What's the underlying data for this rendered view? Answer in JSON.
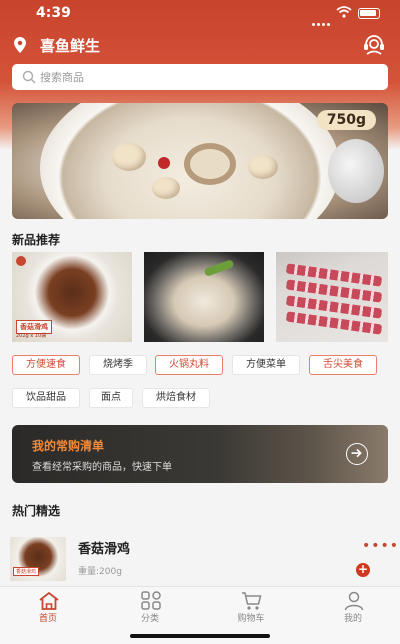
{
  "status_bar": {
    "time": "4:39"
  },
  "header": {
    "app_title": "喜鱼鲜生"
  },
  "search": {
    "placeholder": "搜索商品"
  },
  "banner": {
    "weight_label": "750g"
  },
  "new_products": {
    "title": "新品推荐",
    "items": [
      {
        "name": "香菇滑鸡",
        "image_text": "香菇滑鸡",
        "image_subtext": "202g x 10袋"
      },
      {
        "name": "",
        "image_text": ""
      },
      {
        "name": "",
        "image_text": ""
      }
    ]
  },
  "category_tags": [
    {
      "label": "方便速食",
      "style": "red"
    },
    {
      "label": "烧烤季",
      "style": "gray"
    },
    {
      "label": "火锅丸料",
      "style": "red"
    },
    {
      "label": "方便菜单",
      "style": "gray"
    },
    {
      "label": "舌尖美食",
      "style": "red"
    },
    {
      "label": "饮品甜品",
      "style": "gray"
    },
    {
      "label": "面点",
      "style": "gray"
    },
    {
      "label": "烘焙食材",
      "style": "gray"
    }
  ],
  "frequent_list": {
    "title": "我的常购清单",
    "subtitle": "查看经常采购的商品，快速下单"
  },
  "hot_picks": {
    "title": "热门精选",
    "items": [
      {
        "name": "香菇滑鸡",
        "weight": "重量:200g",
        "image_text": "香菇滑鸡"
      }
    ]
  },
  "tab_bar": {
    "tabs": [
      {
        "label": "首页",
        "icon": "home-icon",
        "active": true
      },
      {
        "label": "分类",
        "icon": "category-icon",
        "active": false
      },
      {
        "label": "购物车",
        "icon": "cart-icon",
        "active": false
      },
      {
        "label": "我的",
        "icon": "profile-icon",
        "active": false
      }
    ]
  },
  "colors": {
    "brand": "#c8432c",
    "accent_orange": "#f08a3a",
    "tag_red": "#d04a32"
  }
}
